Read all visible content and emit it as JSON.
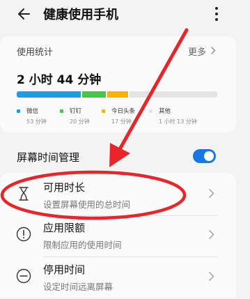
{
  "header": {
    "back_icon": "arrow-left-icon",
    "title": "健康使用手机",
    "more_icon": "more-vertical-icon"
  },
  "usage": {
    "label": "使用统计",
    "more_label": "更多",
    "total": "2 小时 44 分钟",
    "apps": [
      {
        "name": "微信",
        "time": "53 分钟",
        "minutes": 53,
        "color": "#1e9be6"
      },
      {
        "name": "钉钉",
        "time": "20 分钟",
        "minutes": 20,
        "color": "#3cc94e"
      },
      {
        "name": "今日头条",
        "time": "17 分钟",
        "minutes": 17,
        "color": "#f5b400"
      },
      {
        "name": "其他",
        "time": "1 小时 13 分钟",
        "minutes": 73,
        "color": "#e4e4e4"
      }
    ]
  },
  "screen_time": {
    "title": "屏幕时间管理",
    "enabled": true,
    "accent": "#1677e5"
  },
  "rows": [
    {
      "title": "可用时长",
      "subtitle": "设置屏幕使用的总时间",
      "icon": "hourglass-icon"
    },
    {
      "title": "应用限额",
      "subtitle": "限制应用的使用时间",
      "icon": "alert-circle-icon"
    },
    {
      "title": "停用时间",
      "subtitle": "设定时间远离屏幕",
      "icon": "minus-circle-icon"
    }
  ],
  "annotation": {
    "color": "#e8262a"
  }
}
